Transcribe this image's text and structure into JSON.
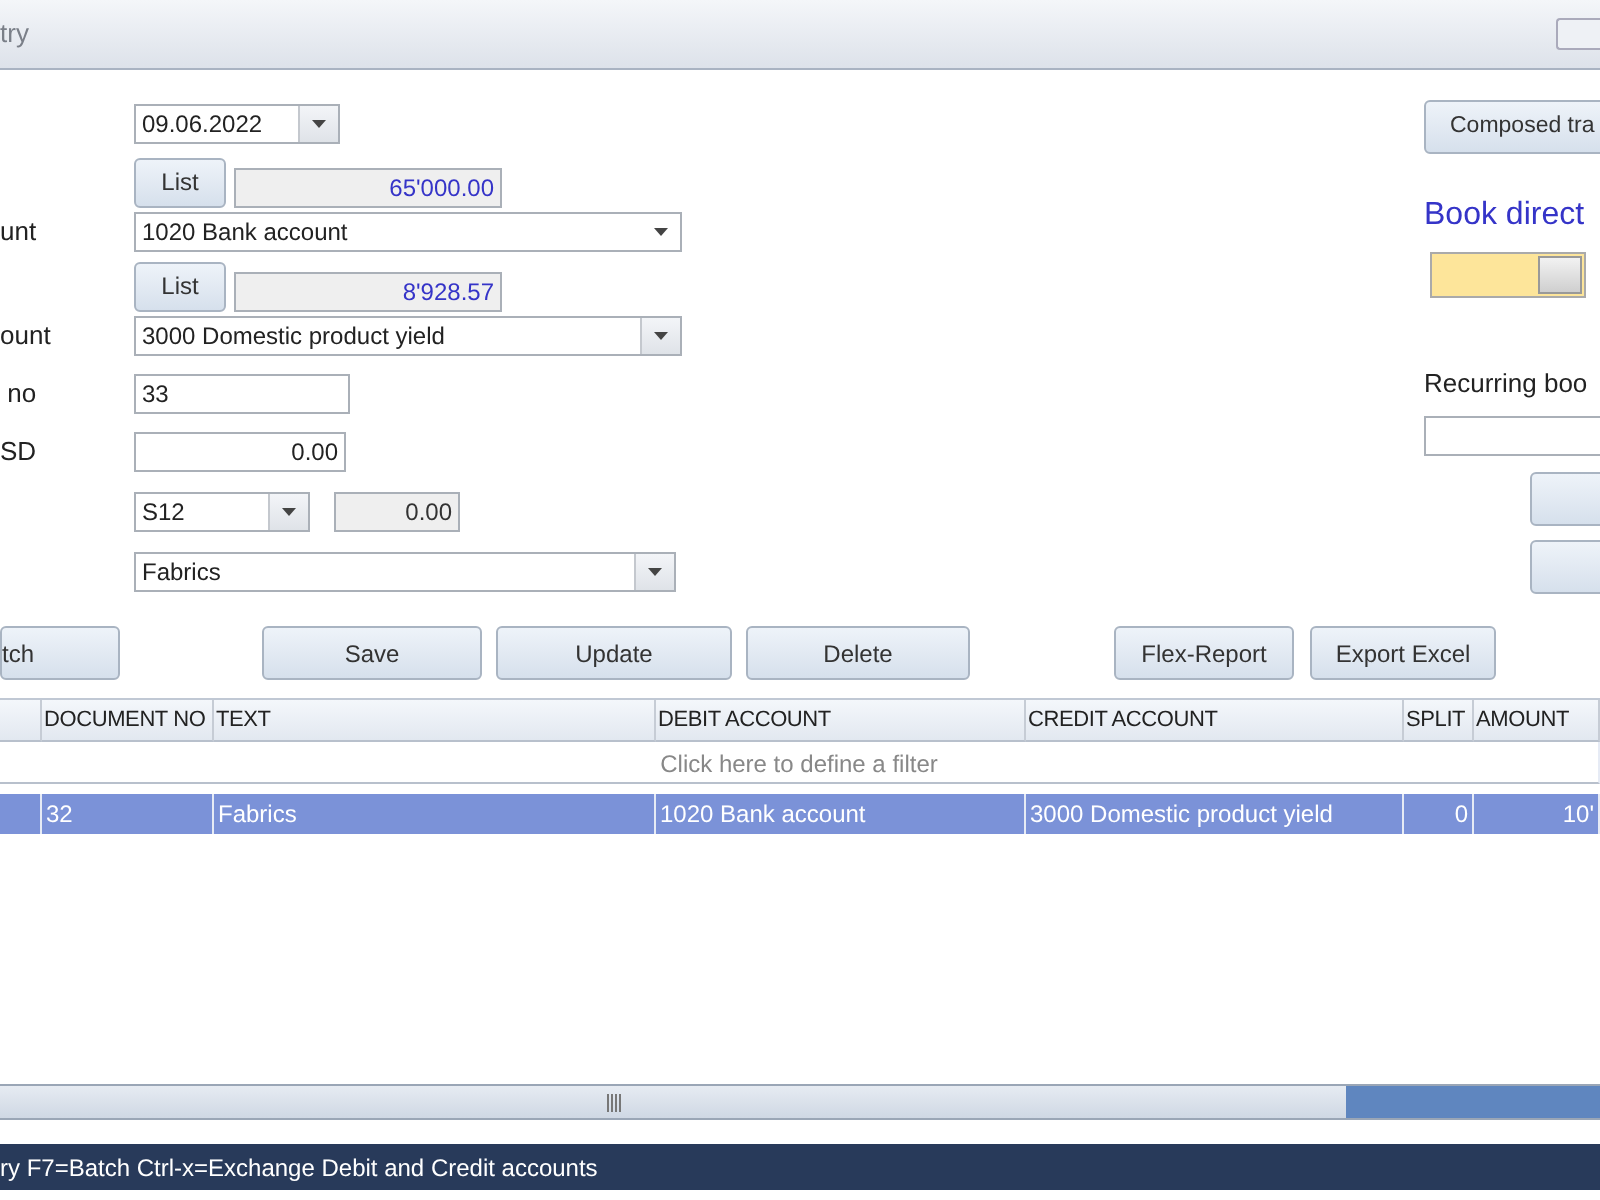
{
  "window": {
    "title": "try"
  },
  "form": {
    "date": "09.06.2022",
    "debit": {
      "list_button": "List",
      "balance": "65'000.00",
      "label": "unt",
      "account": "1020 Bank account"
    },
    "credit": {
      "list_button": "List",
      "balance": "8'928.57",
      "label": "ount",
      "account": "3000 Domestic product yield"
    },
    "document_no": {
      "label": " no",
      "value": "33"
    },
    "amount": {
      "label": "SD",
      "value": "0.00"
    },
    "vat": {
      "code": "S12",
      "value": "0.00"
    },
    "text": "Fabrics"
  },
  "side": {
    "composed_button": "Composed tra",
    "book_direct": "Book direct",
    "book_direct_toggle": {
      "on": true
    },
    "recurring_label": "Recurring boo"
  },
  "buttons": [
    "tch",
    "Save",
    "Update",
    "Delete",
    "Flex-Report",
    "Export Excel"
  ],
  "table": {
    "columns": [
      "",
      "DOCUMENT NO",
      "TEXT",
      "DEBIT ACCOUNT",
      "CREDIT ACCOUNT",
      "SPLIT",
      "AMOUNT"
    ],
    "filter_hint": "Click here to define a filter",
    "rows": [
      {
        "selected": true,
        "cells": [
          "",
          "32",
          "Fabrics",
          "1020 Bank account",
          "3000 Domestic product yield",
          "0",
          "10'"
        ]
      }
    ]
  },
  "status_bar": "ry F7=Batch Ctrl-x=Exchange Debit and Credit accounts"
}
